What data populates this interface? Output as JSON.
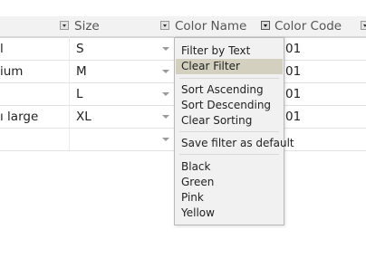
{
  "header": {
    "columns": [
      {
        "label": "Size",
        "filter_active": false
      },
      {
        "label": "Color Name",
        "filter_active": false
      },
      {
        "label": "Color Code",
        "filter_active": true
      }
    ]
  },
  "rows": [
    {
      "name": "l",
      "size": "S",
      "code": "01"
    },
    {
      "name": "ium",
      "size": "M",
      "code": "01"
    },
    {
      "name": "",
      "size": "L",
      "code": "01"
    },
    {
      "name": "ı large",
      "size": "XL",
      "code": "01"
    },
    {
      "name": "",
      "size": "",
      "code": ""
    }
  ],
  "filter_menu": {
    "items": {
      "filter_by_text": "Filter by Text",
      "clear_filter": "Clear Filter",
      "sort_ascending": "Sort Ascending",
      "sort_descending": "Sort Descending",
      "clear_sorting": "Clear Sorting",
      "save_default": "Save filter as default"
    },
    "highlighted": "Clear Filter",
    "values": [
      "Black",
      "Green",
      "Pink",
      "Yellow"
    ]
  },
  "colors": {
    "header_bg": "#f2f2f2",
    "menu_bg": "#f1f1f1",
    "menu_highlight": "#d3d0bf"
  }
}
